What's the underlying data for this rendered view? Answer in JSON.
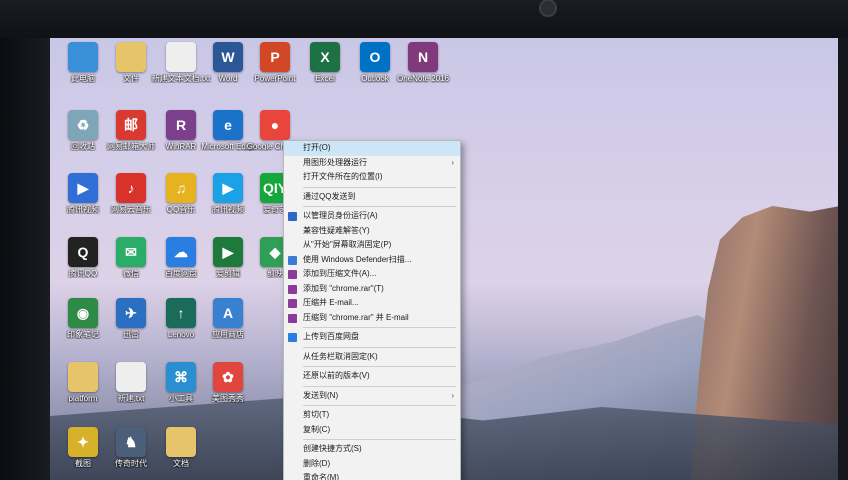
{
  "desktop": {
    "icons": [
      {
        "label": "此电脑",
        "glyph": "",
        "color": "#3a8fd9"
      },
      {
        "label": "文件",
        "glyph": "",
        "color": "#e6c46a"
      },
      {
        "label": "新建文本文档.txt",
        "glyph": "",
        "color": "#eeeeee"
      },
      {
        "label": "Word",
        "glyph": "W",
        "color": "#2b5797"
      },
      {
        "label": "PowerPoint",
        "glyph": "P",
        "color": "#d24726"
      },
      {
        "label": "Excel",
        "glyph": "X",
        "color": "#1e7145"
      },
      {
        "label": "Outlook",
        "glyph": "O",
        "color": "#0072c6"
      },
      {
        "label": "OneNote 2016",
        "glyph": "N",
        "color": "#80397b"
      },
      {
        "label": "回收站",
        "glyph": "♻",
        "color": "#7fa6b8"
      },
      {
        "label": "网易邮箱大师",
        "glyph": "邮",
        "color": "#d93a2f"
      },
      {
        "label": "WinRAR",
        "glyph": "R",
        "color": "#7b3f8c"
      },
      {
        "label": "Microsoft Edge",
        "glyph": "e",
        "color": "#1a73c9"
      },
      {
        "label": "Google Chrome",
        "glyph": "●",
        "color": "#e8453c"
      },
      {
        "label": "腾讯视频",
        "glyph": "▶",
        "color": "#2f6fd6"
      },
      {
        "label": "网易云音乐",
        "glyph": "♪",
        "color": "#d8322b"
      },
      {
        "label": "QQ音乐",
        "glyph": "♫",
        "color": "#e6b21f"
      },
      {
        "label": "腾讯视频",
        "glyph": "▶",
        "color": "#1aa1e6"
      },
      {
        "label": "爱奇艺",
        "glyph": "QIY",
        "color": "#14a83b"
      },
      {
        "label": "腾讯QQ",
        "glyph": "Q",
        "color": "#222222"
      },
      {
        "label": "微信",
        "glyph": "✉",
        "color": "#2aae67"
      },
      {
        "label": "百度网盘",
        "glyph": "☁",
        "color": "#2a7de1"
      },
      {
        "label": "爱剪辑",
        "glyph": "▶",
        "color": "#1d7a3a"
      },
      {
        "label": "剪映",
        "glyph": "◆",
        "color": "#2f9e56"
      },
      {
        "label": "印象笔记",
        "glyph": "◉",
        "color": "#2e8b45"
      },
      {
        "label": "迅雷",
        "glyph": "✈",
        "color": "#2a6fc2"
      },
      {
        "label": "Lenovo",
        "glyph": "↑",
        "color": "#1b6b5a"
      },
      {
        "label": "应用商店",
        "glyph": "A",
        "color": "#3a80d0"
      },
      {
        "label": "platform",
        "glyph": "",
        "color": "#e6c46a"
      },
      {
        "label": "新建.txt",
        "glyph": "",
        "color": "#eeeeee"
      },
      {
        "label": "小工具",
        "glyph": "⌘",
        "color": "#2a8fd0"
      },
      {
        "label": "美图秀秀",
        "glyph": "✿",
        "color": "#e0463d"
      },
      {
        "label": "截图",
        "glyph": "✦",
        "color": "#d8b12a"
      },
      {
        "label": "传奇时代",
        "glyph": "♞",
        "color": "#4b5f7a"
      },
      {
        "label": "文档",
        "glyph": "",
        "color": "#e6c46a"
      }
    ]
  },
  "context_menu": {
    "items": [
      {
        "label": "打开(O)",
        "highlight": true,
        "icon": "",
        "arrow": false
      },
      {
        "label": "用图形处理器运行",
        "icon": "",
        "arrow": true
      },
      {
        "label": "打开文件所在的位置(I)",
        "icon": "",
        "arrow": false
      },
      {
        "sep": true
      },
      {
        "label": "通过QQ发送到",
        "icon": "",
        "arrow": false
      },
      {
        "sep": true
      },
      {
        "label": "以管理员身份运行(A)",
        "icon": "shield",
        "arrow": false
      },
      {
        "label": "兼容性疑难解答(Y)",
        "icon": "",
        "arrow": false
      },
      {
        "label": "从\"开始\"屏幕取消固定(P)",
        "icon": "",
        "arrow": false
      },
      {
        "label": "使用 Windows Defender扫描...",
        "icon": "defender",
        "arrow": false
      },
      {
        "label": "添加到压缩文件(A)...",
        "icon": "rar",
        "arrow": false
      },
      {
        "label": "添加到 \"chrome.rar\"(T)",
        "icon": "rar",
        "arrow": false
      },
      {
        "label": "压缩并 E-mail...",
        "icon": "rar",
        "arrow": false
      },
      {
        "label": "压缩到 \"chrome.rar\" 并 E-mail",
        "icon": "rar",
        "arrow": false
      },
      {
        "sep": true
      },
      {
        "label": "上传到百度网盘",
        "icon": "cloud",
        "arrow": false
      },
      {
        "sep": true
      },
      {
        "label": "从任务栏取消固定(K)",
        "icon": "",
        "arrow": false
      },
      {
        "sep": true
      },
      {
        "label": "还原以前的版本(V)",
        "icon": "",
        "arrow": false
      },
      {
        "sep": true
      },
      {
        "label": "发送到(N)",
        "icon": "",
        "arrow": true
      },
      {
        "sep": true
      },
      {
        "label": "剪切(T)",
        "icon": "",
        "arrow": false
      },
      {
        "label": "复制(C)",
        "icon": "",
        "arrow": false
      },
      {
        "sep": true
      },
      {
        "label": "创建快捷方式(S)",
        "icon": "",
        "arrow": false
      },
      {
        "label": "删除(D)",
        "icon": "",
        "arrow": false
      },
      {
        "label": "重命名(M)",
        "icon": "",
        "arrow": false
      }
    ]
  }
}
